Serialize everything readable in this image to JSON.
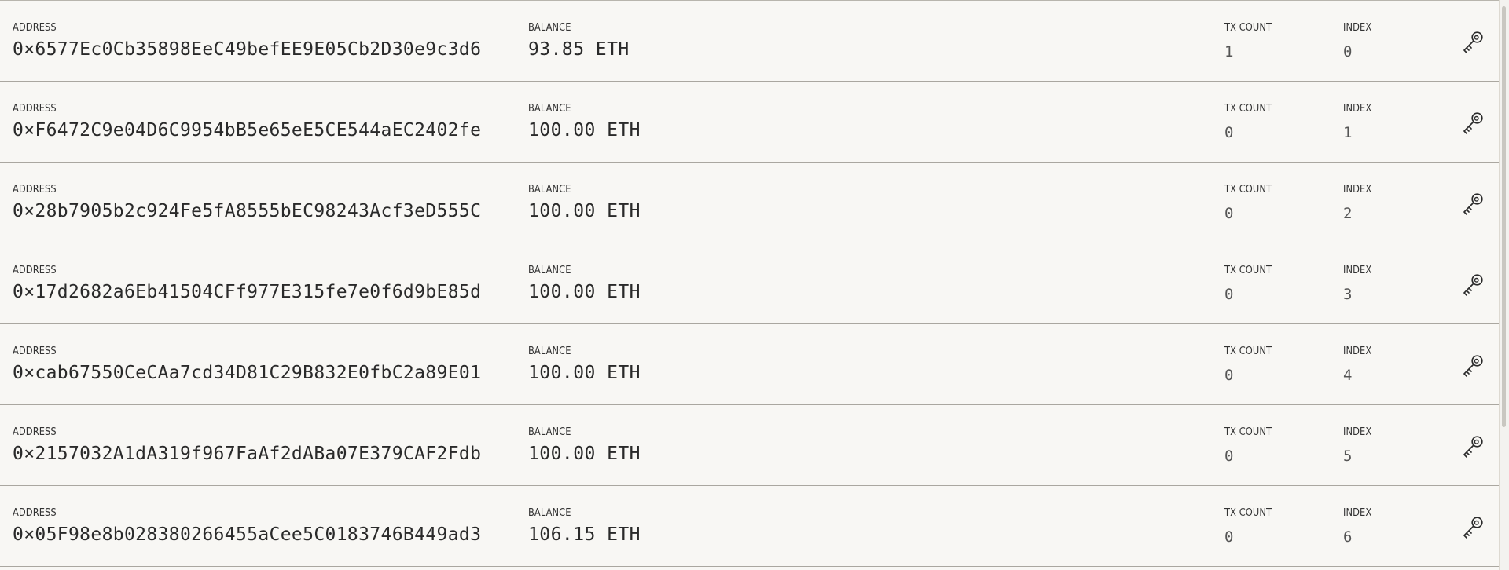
{
  "labels": {
    "address": "ADDRESS",
    "balance": "BALANCE",
    "tx_count": "TX COUNT",
    "index": "INDEX"
  },
  "accounts": [
    {
      "address": "0×6577Ec0Cb35898EeC49befEE9E05Cb2D30e9c3d6",
      "balance": "93.85 ETH",
      "tx_count": "1",
      "index": "0",
      "action_icon": "key-icon"
    },
    {
      "address": "0×F6472C9e04D6C9954bB5e65eE5CE544aEC2402fe",
      "balance": "100.00 ETH",
      "tx_count": "0",
      "index": "1",
      "action_icon": "key-icon"
    },
    {
      "address": "0×28b7905b2c924Fe5fA8555bEC98243Acf3eD555C",
      "balance": "100.00 ETH",
      "tx_count": "0",
      "index": "2",
      "action_icon": "key-icon"
    },
    {
      "address": "0×17d2682a6Eb41504CFf977E315fe7e0f6d9bE85d",
      "balance": "100.00 ETH",
      "tx_count": "0",
      "index": "3",
      "action_icon": "key-icon"
    },
    {
      "address": "0×cab67550CeCAa7cd34D81C29B832E0fbC2a89E01",
      "balance": "100.00 ETH",
      "tx_count": "0",
      "index": "4",
      "action_icon": "key-icon"
    },
    {
      "address": "0×2157032A1dA319f967FaAf2dABa07E379CAF2Fdb",
      "balance": "100.00 ETH",
      "tx_count": "0",
      "index": "5",
      "action_icon": "key-icon"
    },
    {
      "address": "0×05F98e8b028380266455aCee5C0183746B449ad3",
      "balance": "106.15 ETH",
      "tx_count": "0",
      "index": "6",
      "action_icon": "key-icon"
    }
  ],
  "colors": {
    "background": "#f8f7f4",
    "divider": "#aaa7a0",
    "text": "#2f2f2f",
    "muted_text": "#555555",
    "scrollbar_thumb": "#c9c7c1"
  },
  "scroll_position": "top"
}
